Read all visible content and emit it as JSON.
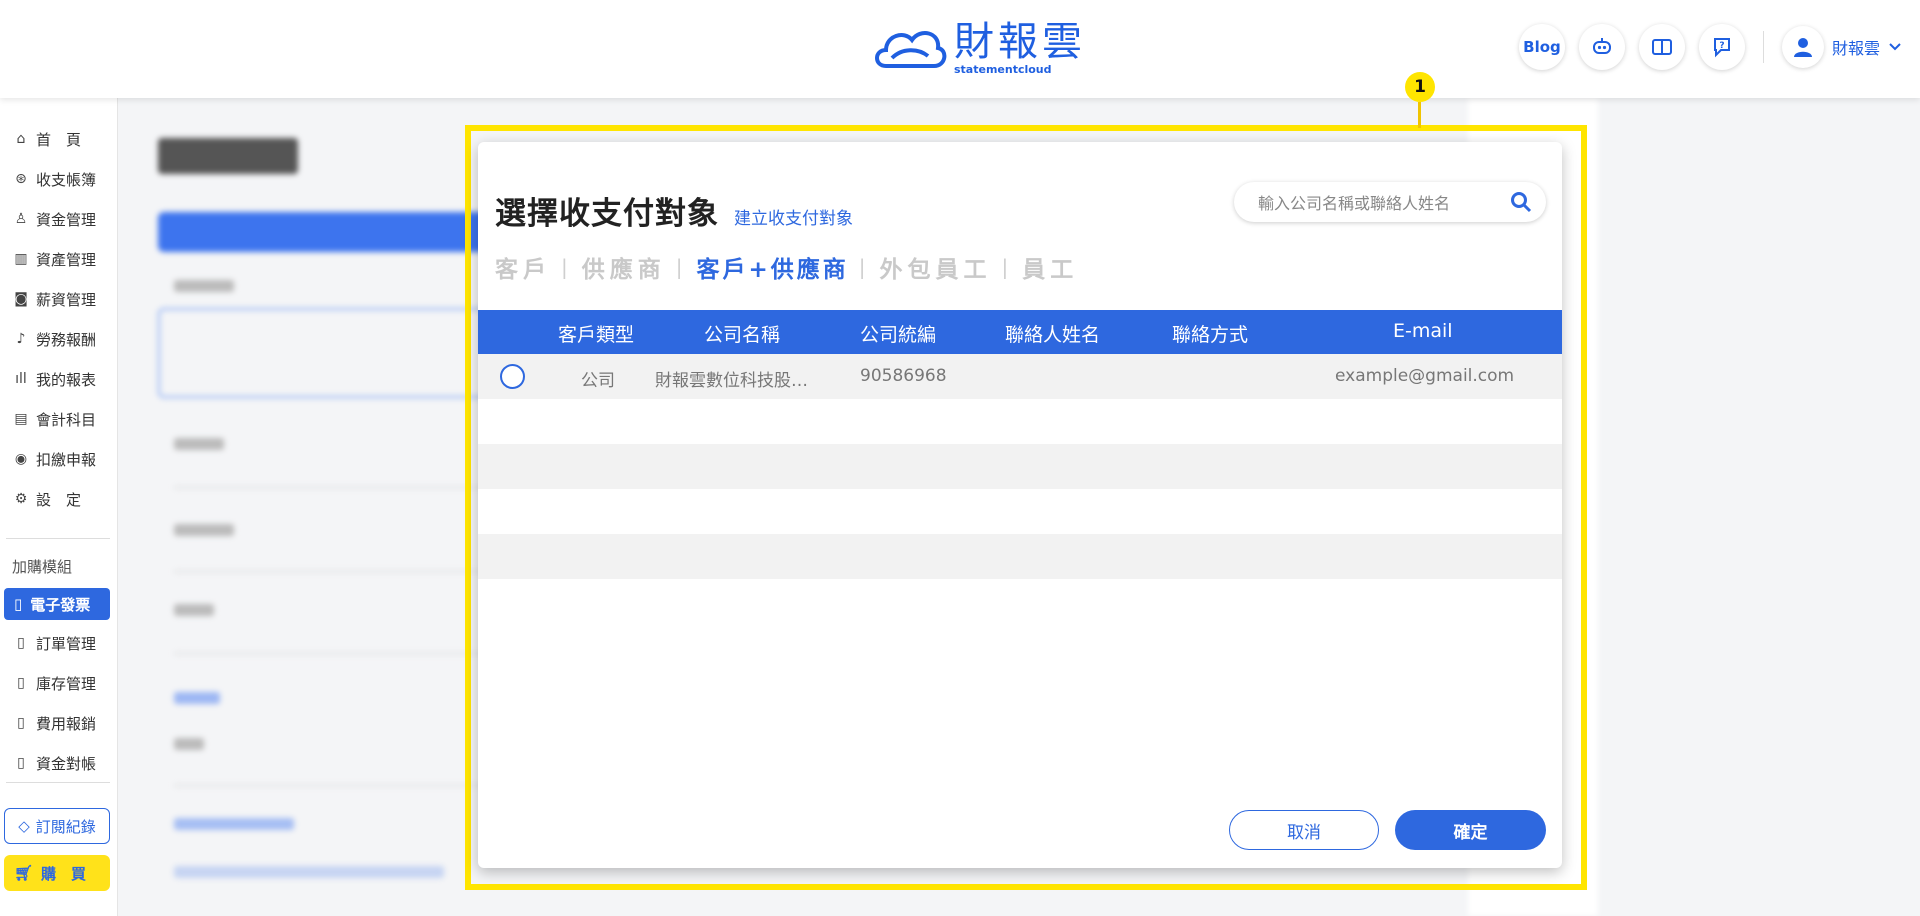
{
  "header": {
    "logo_cn": "財報雲",
    "logo_en": "statementcloud",
    "blog_label": "Blog",
    "user_name": "財報雲"
  },
  "sidebar": {
    "items": [
      {
        "icon": "home-icon",
        "label": "首　頁"
      },
      {
        "icon": "income-book-icon",
        "label": "收支帳簿"
      },
      {
        "icon": "fund-icon",
        "label": "資金管理"
      },
      {
        "icon": "asset-icon",
        "label": "資產管理"
      },
      {
        "icon": "salary-icon",
        "label": "薪資管理"
      },
      {
        "icon": "labor-icon",
        "label": "勞務報酬"
      },
      {
        "icon": "report-icon",
        "label": "我的報表"
      },
      {
        "icon": "accounting-icon",
        "label": "會計科目"
      },
      {
        "icon": "tax-icon",
        "label": "扣繳申報"
      },
      {
        "icon": "settings-icon",
        "label": "設　定"
      }
    ],
    "addon_section": "加購模組",
    "addon_items": [
      {
        "label": "電子發票",
        "active": true
      },
      {
        "label": "訂單管理"
      },
      {
        "label": "庫存管理"
      },
      {
        "label": "費用報銷"
      },
      {
        "label": "資金對帳"
      }
    ],
    "subscription_button": "訂閱紀錄",
    "buy_button": "購　買"
  },
  "highlight_badge": "1",
  "modal": {
    "title": "選擇收支付對象",
    "create_link": "建立收支付對象",
    "search_placeholder": "輸入公司名稱或聯絡人姓名",
    "tabs": [
      "客戶",
      "供應商",
      "客戶+供應商",
      "外包員工",
      "員工"
    ],
    "active_tab": "客戶+供應商",
    "columns": [
      "客戶類型",
      "公司名稱",
      "公司統編",
      "聯絡人姓名",
      "聯絡方式",
      "E-mail"
    ],
    "rows": [
      {
        "type": "公司",
        "company": "財報雲數位科技股…",
        "tax_id": "90586968",
        "contact": "",
        "method": "",
        "email": "example@gmail.com"
      }
    ],
    "cancel_label": "取消",
    "confirm_label": "確定"
  },
  "colors": {
    "primary": "#2e68df",
    "highlight": "#ffe500",
    "buy": "#ffe21a"
  }
}
